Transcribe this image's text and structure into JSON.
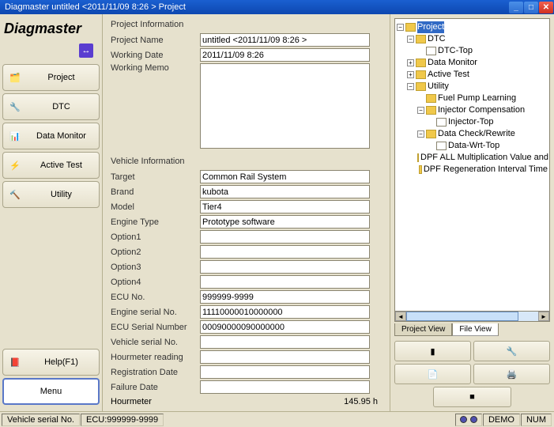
{
  "titlebar": {
    "title": "Diagmaster untitled <2011/11/09 8:26 > Project"
  },
  "sidebar": {
    "app_title": "Diagmaster",
    "buttons": {
      "project": "Project",
      "dtc": "DTC",
      "data_monitor": "Data Monitor",
      "active_test": "Active Test",
      "utility": "Utility",
      "help": "Help(F1)",
      "menu": "Menu"
    }
  },
  "project_info": {
    "heading": "Project Information",
    "project_name_label": "Project Name",
    "project_name_value": "untitled <2011/11/09 8:26 >",
    "working_date_label": "Working Date",
    "working_date_value": "2011/11/09 8:26",
    "working_memo_label": "Working Memo",
    "working_memo_value": ""
  },
  "vehicle_info": {
    "heading": "Vehicle Information",
    "target_label": "Target",
    "target_value": "Common Rail System",
    "brand_label": "Brand",
    "brand_value": "kubota",
    "model_label": "Model",
    "model_value": "Tier4",
    "engine_type_label": "Engine Type",
    "engine_type_value": "Prototype software",
    "option1_label": "Option1",
    "option1_value": "",
    "option2_label": "Option2",
    "option2_value": "",
    "option3_label": "Option3",
    "option3_value": "",
    "option4_label": "Option4",
    "option4_value": "",
    "ecu_no_label": "ECU No.",
    "ecu_no_value": "999999-9999",
    "engine_serial_label": "Engine serial No.",
    "engine_serial_value": "11110000010000000",
    "ecu_serial_label": "ECU Serial Number",
    "ecu_serial_value": "00090000090000000",
    "vehicle_serial_label": "Vehicle serial No.",
    "vehicle_serial_value": "",
    "hourmeter_reading_label": "Hourmeter reading",
    "hourmeter_reading_value": "",
    "registration_date_label": "Registration Date",
    "registration_date_value": "",
    "failure_date_label": "Failure Date",
    "failure_date_value": "",
    "hourmeter_label": "Hourmeter",
    "hourmeter_value": "145.95 h"
  },
  "tree": {
    "project": "Project",
    "dtc": "DTC",
    "dtc_top": "DTC-Top",
    "data_monitor": "Data Monitor",
    "active_test": "Active Test",
    "utility": "Utility",
    "fuel_pump": "Fuel Pump Learning",
    "injector_comp": "Injector Compensation",
    "injector_top": "Injector-Top",
    "data_check": "Data Check/Rewrite",
    "data_wrt_top": "Data-Wrt-Top",
    "dpf_all": "DPF ALL Multiplication Value and",
    "dpf_regen": "DPF Regeneration Interval Time"
  },
  "tabs": {
    "project_view": "Project View",
    "file_view": "File View"
  },
  "statusbar": {
    "vehicle_serial": "Vehicle serial No.",
    "ecu": "ECU:999999-9999",
    "demo": "DEMO",
    "num": "NUM"
  }
}
